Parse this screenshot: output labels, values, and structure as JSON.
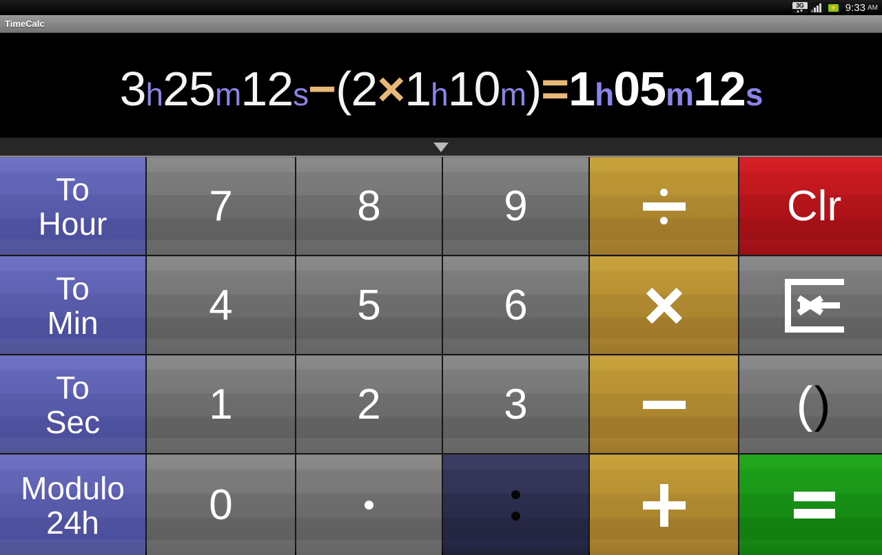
{
  "statusbar": {
    "network_label": "3G",
    "time": "9:33",
    "ampm": "AM",
    "battery_glyph": "⚡",
    "icons": [
      "3g-data-icon",
      "signal-bars-icon",
      "battery-charging-icon"
    ]
  },
  "titlebar": {
    "app_title": "TimeCalc"
  },
  "display": {
    "expression_raw": "3h25m12s−(2×1h10m)=1h05m12s",
    "operand1": {
      "hours": "3",
      "h": "h",
      "minutes": "25",
      "m": "m",
      "seconds": "12",
      "s": "s"
    },
    "minus": "−",
    "paren_open": "(",
    "factor": "2",
    "multiply": "×",
    "operand2": {
      "hours": "1",
      "h": "h",
      "minutes": "10",
      "m": "m"
    },
    "paren_close": ")",
    "equals": "=",
    "result": {
      "hours": "1",
      "h": "h",
      "minutes": "05",
      "m": "m",
      "seconds": "12",
      "s": "s"
    }
  },
  "handle": {
    "chevron": "chevron-down-icon"
  },
  "keypad": {
    "rows": [
      [
        {
          "name": "to-hour",
          "label": "To\nHour",
          "line1": "To",
          "line2": "Hour",
          "style": "blue",
          "kind": "text"
        },
        {
          "name": "digit-7",
          "label": "7",
          "style": "gray",
          "kind": "text"
        },
        {
          "name": "digit-8",
          "label": "8",
          "style": "gray",
          "kind": "text"
        },
        {
          "name": "digit-9",
          "label": "9",
          "style": "gray",
          "kind": "text"
        },
        {
          "name": "divide",
          "label": "÷",
          "style": "gold",
          "kind": "glyph-divide"
        },
        {
          "name": "clear",
          "label": "Clr",
          "style": "red",
          "kind": "text"
        }
      ],
      [
        {
          "name": "to-min",
          "label": "To\nMin",
          "line1": "To",
          "line2": "Min",
          "style": "blue",
          "kind": "text"
        },
        {
          "name": "digit-4",
          "label": "4",
          "style": "gray",
          "kind": "text"
        },
        {
          "name": "digit-5",
          "label": "5",
          "style": "gray",
          "kind": "text"
        },
        {
          "name": "digit-6",
          "label": "6",
          "style": "gray",
          "kind": "text"
        },
        {
          "name": "multiply",
          "label": "×",
          "style": "gold",
          "kind": "glyph-times"
        },
        {
          "name": "backspace",
          "label": "",
          "style": "gray",
          "kind": "glyph-backspace"
        }
      ],
      [
        {
          "name": "to-sec",
          "label": "To\nSec",
          "line1": "To",
          "line2": "Sec",
          "style": "blue",
          "kind": "text"
        },
        {
          "name": "digit-1",
          "label": "1",
          "style": "gray",
          "kind": "text"
        },
        {
          "name": "digit-2",
          "label": "2",
          "style": "gray",
          "kind": "text"
        },
        {
          "name": "digit-3",
          "label": "3",
          "style": "gray",
          "kind": "text"
        },
        {
          "name": "subtract",
          "label": "−",
          "style": "gold",
          "kind": "glyph-minus"
        },
        {
          "name": "parens",
          "label": "( )",
          "style": "gray",
          "kind": "glyph-paren"
        }
      ],
      [
        {
          "name": "modulo-24h",
          "label": "Modulo\n24h",
          "line1": "Modulo",
          "line2": "24h",
          "style": "blue",
          "kind": "text"
        },
        {
          "name": "digit-0",
          "label": "0",
          "style": "gray",
          "kind": "text"
        },
        {
          "name": "decimal",
          "label": "·",
          "style": "gray",
          "kind": "glyph-dot"
        },
        {
          "name": "colon",
          "label": ":",
          "style": "navy",
          "kind": "glyph-colon"
        },
        {
          "name": "add",
          "label": "+",
          "style": "gold",
          "kind": "glyph-plus"
        },
        {
          "name": "equals",
          "label": "=",
          "style": "green",
          "kind": "glyph-equals"
        }
      ]
    ]
  },
  "colors": {
    "display_bg": "#000000",
    "unit_purple": "#8b85e8",
    "operator_orange": "#e8b878",
    "key_blue": "#5b5eae",
    "key_gold": "#b08a31",
    "key_red": "#b4151b",
    "key_green": "#188f16",
    "key_navy": "#2c2e4f",
    "key_gray": "#6e6e6e",
    "titlebar_gray": "#8b8b8b"
  }
}
